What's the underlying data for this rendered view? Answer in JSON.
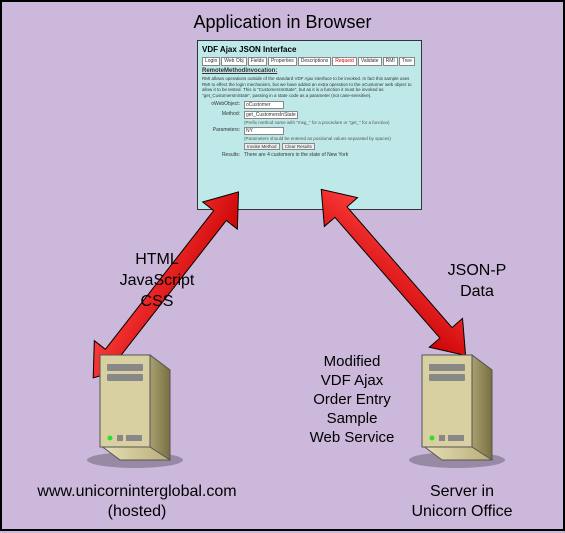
{
  "title": "Application in Browser",
  "browser": {
    "heading": "VDF Ajax JSON Interface",
    "tabs": [
      "Login",
      "Web Obj",
      "Fields",
      "Properties",
      "Descriptions",
      "Request",
      "Validate",
      "RMI",
      "Tree"
    ],
    "active_tab": "Request",
    "section_heading": "RemoteMethodInvocation:",
    "description": "RMI allows operations outside of the standard VDF Ajax interface to be invoked. In fact this sample uses RMI to effect the login mechanism, but we have added an extra operation to the oCustomer web object to allow it to be tested. This is \"CustomersInState\", but as it is a function it must be invoked as \"get_CustomersInState\", passing in a state code as a parameter (not case-sensitive).",
    "fields": {
      "oWebObject": {
        "label": "oWebObject:",
        "value": "oCustomer"
      },
      "method": {
        "label": "Method:",
        "value": "get_CustomersInState",
        "note": "(Prefix method name with \"msg_\" for a procedure or \"get_\" for a function)"
      },
      "parameters": {
        "label": "Parameters:",
        "value": "NY",
        "note": "(Parameters should be entered as positional values separated by spaces)"
      },
      "results": {
        "label": "Results:",
        "value": "There are 4 customers in the state of New York"
      }
    },
    "buttons": {
      "invoke": "Invoke Method",
      "clear": "Clear Results"
    }
  },
  "arrows": {
    "left": {
      "l1": "HTML",
      "l2": "JavaScript",
      "l3": "CSS"
    },
    "right": {
      "l1": "JSON-P",
      "l2": "Data"
    }
  },
  "server_left": {
    "caption_l1": "www.unicorninterglobal.com",
    "caption_l2": "(hosted)"
  },
  "server_right": {
    "desc_l1": "Modified",
    "desc_l2": "VDF Ajax",
    "desc_l3": "Order Entry",
    "desc_l4": "Sample",
    "desc_l5": "Web Service",
    "caption_l1": "Server in",
    "caption_l2": "Unicorn Office"
  }
}
